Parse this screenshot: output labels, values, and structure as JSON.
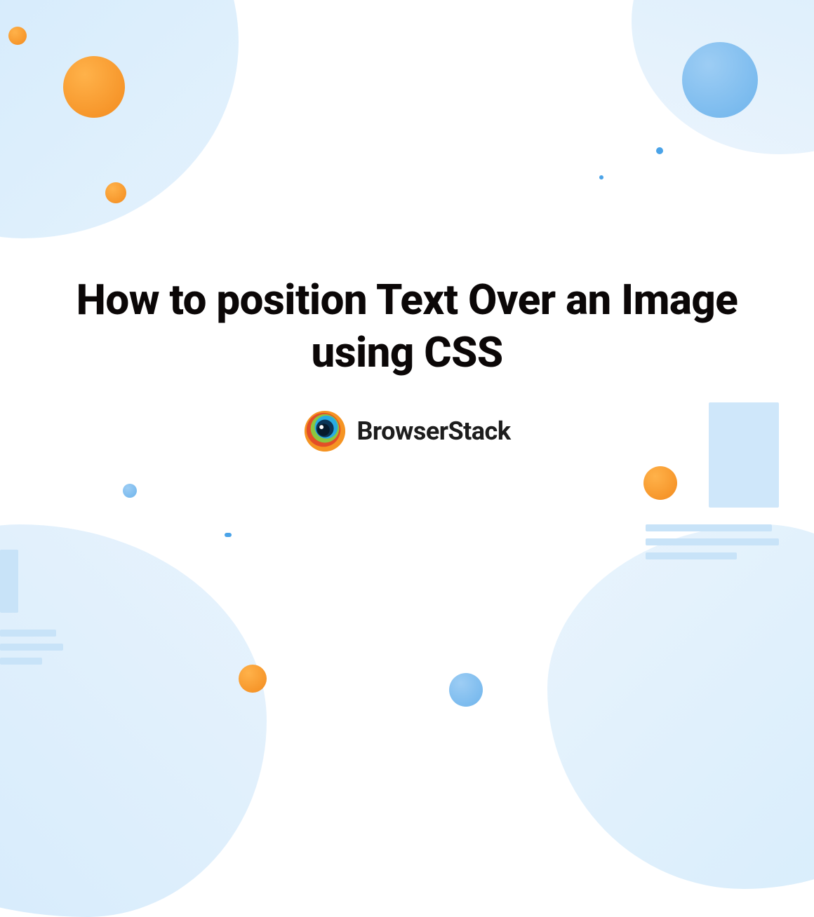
{
  "title": "How to position Text Over an Image using CSS",
  "brand": {
    "name": "BrowserStack"
  },
  "colors": {
    "bg_blob": "#d4ebfb",
    "orange": "#f59423",
    "blue": "#6eb4ec",
    "text": "#0b0707"
  }
}
